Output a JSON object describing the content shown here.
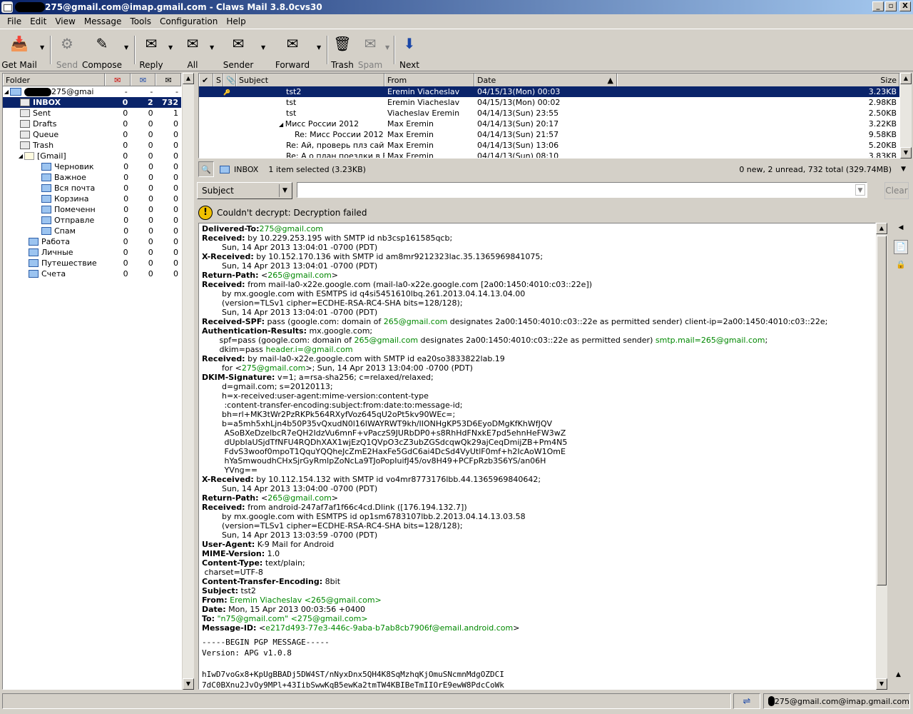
{
  "window": {
    "title": "275@gmail.com@imap.gmail.com - Claws Mail 3.8.0cvs30",
    "buttons": [
      "_",
      "▫",
      "X"
    ]
  },
  "menu": [
    "File",
    "Edit",
    "View",
    "Message",
    "Tools",
    "Configuration",
    "Help"
  ],
  "toolbar": {
    "get_mail": "Get Mail",
    "send": "Send",
    "compose": "Compose",
    "reply": "Reply",
    "all": "All",
    "sender": "Sender",
    "forward": "Forward",
    "trash": "Trash",
    "spam": "Spam",
    "next": "Next"
  },
  "folders": {
    "header": "Folder",
    "account": "275@gmai",
    "account_counts": [
      "-",
      "-",
      "-"
    ],
    "items": [
      {
        "name": "INBOX",
        "new": "0",
        "unread": "2",
        "total": "732"
      },
      {
        "name": "Sent",
        "new": "0",
        "unread": "0",
        "total": "1"
      },
      {
        "name": "Drafts",
        "new": "0",
        "unread": "0",
        "total": "0"
      },
      {
        "name": "Queue",
        "new": "0",
        "unread": "0",
        "total": "0"
      },
      {
        "name": "Trash",
        "new": "0",
        "unread": "0",
        "total": "0"
      },
      {
        "name": "[Gmail]",
        "new": "0",
        "unread": "0",
        "total": "0"
      },
      {
        "name": "Черновик",
        "new": "0",
        "unread": "0",
        "total": "0"
      },
      {
        "name": "Важное",
        "new": "0",
        "unread": "0",
        "total": "0"
      },
      {
        "name": "Вся почта",
        "new": "0",
        "unread": "0",
        "total": "0"
      },
      {
        "name": "Корзина",
        "new": "0",
        "unread": "0",
        "total": "0"
      },
      {
        "name": "Помеченн",
        "new": "0",
        "unread": "0",
        "total": "0"
      },
      {
        "name": "Отправле",
        "new": "0",
        "unread": "0",
        "total": "0"
      },
      {
        "name": "Спам",
        "new": "0",
        "unread": "0",
        "total": "0"
      },
      {
        "name": "Работа",
        "new": "0",
        "unread": "0",
        "total": "0"
      },
      {
        "name": "Личные",
        "new": "0",
        "unread": "0",
        "total": "0"
      },
      {
        "name": "Путешествие",
        "new": "0",
        "unread": "0",
        "total": "0"
      },
      {
        "name": "Счета",
        "new": "0",
        "unread": "0",
        "total": "0"
      }
    ]
  },
  "messages": {
    "columns": {
      "s": "S",
      "subject": "Subject",
      "from": "From",
      "date": "Date",
      "size": "Size"
    },
    "rows": [
      {
        "subject": "tst2",
        "from": "Eremin Viacheslav",
        "date": "04/15/13(Mon) 00:03",
        "size": "3.23KB"
      },
      {
        "subject": "tst",
        "from": "Eremin Viacheslav",
        "date": "04/15/13(Mon) 00:02",
        "size": "2.98KB"
      },
      {
        "subject": "tst",
        "from": "Viacheslav Eremin",
        "date": "04/14/13(Sun) 23:55",
        "size": "2.50KB"
      },
      {
        "subject": "Мисс России 2012",
        "from": "Max Eremin",
        "date": "04/14/13(Sun) 20:17",
        "size": "3.22KB"
      },
      {
        "subject": "Re: Мисс России 2012",
        "from": "Max Eremin",
        "date": "04/14/13(Sun) 21:57",
        "size": "9.58KB"
      },
      {
        "subject": "Re: Ай, проверь плз сайт http://rusbc",
        "from": "Max Eremin",
        "date": "04/14/13(Sun) 13:06",
        "size": "5.20KB"
      },
      {
        "subject": "Re: А о план поездки в Бургас перед",
        "from": "Max Eremin",
        "date": "04/14/13(Sun) 08:10",
        "size": "3.83KB"
      }
    ]
  },
  "status_row": {
    "folder": "INBOX",
    "selected": "1 item selected (3.23KB)",
    "totals": "0 new, 2 unread, 732 total (329.74MB)"
  },
  "quicksearch": {
    "type": "Subject",
    "clear": "Clear"
  },
  "warning": "Couldn't decrypt: Decryption failed",
  "headers": [
    {
      "k": "Delivered-To:",
      "v": "",
      "g": "275@gmail.com"
    },
    {
      "k": "Received:",
      "v": " by 10.229.253.195 with SMTP id nb3csp161585qcb;"
    },
    {
      "k": "",
      "v": "        Sun, 14 Apr 2013 13:04:01 -0700 (PDT)"
    },
    {
      "k": "X-Received:",
      "v": " by 10.152.170.136 with SMTP id am8mr9212323lac.35.1365969841075;"
    },
    {
      "k": "",
      "v": "        Sun, 14 Apr 2013 13:04:01 -0700 (PDT)"
    },
    {
      "k": "Return-Path:",
      "v": " <",
      "g": "265@gmail.com",
      "v2": ">"
    },
    {
      "k": "Received:",
      "v": " from mail-la0-x22e.google.com (mail-la0-x22e.google.com [2a00:1450:4010:c03::22e])"
    },
    {
      "k": "",
      "v": "        by mx.google.com with ESMTPS id q4si5451610lbq.261.2013.04.14.13.04.00"
    },
    {
      "k": "",
      "v": "        (version=TLSv1 cipher=ECDHE-RSA-RC4-SHA bits=128/128);"
    },
    {
      "k": "",
      "v": "        Sun, 14 Apr 2013 13:04:01 -0700 (PDT)"
    },
    {
      "k": "Received-SPF:",
      "v": " pass (google.com: domain of ",
      "g": "265@gmail.com",
      "v2": " designates 2a00:1450:4010:c03::22e as permitted sender) client-ip=2a00:1450:4010:c03::22e;"
    },
    {
      "k": "Authentication-Results:",
      "v": " mx.google.com;"
    },
    {
      "k": "",
      "v": "       spf=pass (google.com: domain of ",
      "g": "265@gmail.com",
      "v2": " designates 2a00:1450:4010:c03::22e as permitted sender) ",
      "g2": "smtp.mail=",
      "g3": "265@gmail.com",
      "v3": ";"
    },
    {
      "k": "",
      "v": "       dkim=pass ",
      "g": "header.i=@gmail.com"
    },
    {
      "k": "Received:",
      "v": " by mail-la0-x22e.google.com with SMTP id ea20so3833822lab.19"
    },
    {
      "k": "",
      "v": "        for <",
      "g": "275@gmail.com",
      "v2": ">; Sun, 14 Apr 2013 13:04:00 -0700 (PDT)"
    },
    {
      "k": "DKIM-Signature:",
      "v": " v=1; a=rsa-sha256; c=relaxed/relaxed;"
    },
    {
      "k": "",
      "v": "        d=gmail.com; s=20120113;"
    },
    {
      "k": "",
      "v": "        h=x-received:user-agent:mime-version:content-type"
    },
    {
      "k": "",
      "v": "         :content-transfer-encoding:subject:from:date:to:message-id;"
    },
    {
      "k": "",
      "v": "        bh=rl+MK3tWr2PzRKPk564RXyfVoz645qU2oPt5kv90WEc=;"
    },
    {
      "k": "",
      "v": "        b=a5mh5xhLjn4b50P35vQxudN0l16IWAYRWT9kh/IIONHgKP53D6EyoDMgKfKhWfJQV"
    },
    {
      "k": "",
      "v": "         ASoBXeDzelbcR7eQH2IdzVu6mnF+vPaczS9JURbDP0+s8RhHdFNxkE7pd5ehnHeFW3wZ"
    },
    {
      "k": "",
      "v": "         dUpbIaUSjdTfNFU4RQDhXAX1wjEzQ1QVpO3cZ3ubZGSdcqwQk29ajCeqDmijZB+Pm4N5"
    },
    {
      "k": "",
      "v": "         FdvS3woof0mpoT1QquYQQheJcZmE2HaxFe5GdC6ai4DcSd4VyUtlF0mf+h2IcAoW1OmE"
    },
    {
      "k": "",
      "v": "         hYaSmwoudhCHxSjrGyRmlpZoNcLa9TJoPopIuifJ45/ov8H49+PCFpRzb3S6YS/an06H"
    },
    {
      "k": "",
      "v": "         YVng=="
    },
    {
      "k": "X-Received:",
      "v": " by 10.112.154.132 with SMTP id vo4mr8773176lbb.44.1365969840642;"
    },
    {
      "k": "",
      "v": "        Sun, 14 Apr 2013 13:04:00 -0700 (PDT)"
    },
    {
      "k": "Return-Path:",
      "v": " <",
      "g": "265@gmail.com",
      "v2": ">"
    },
    {
      "k": "Received:",
      "v": " from android-247af7af1f66c4cd.Dlink ([176.194.132.7])"
    },
    {
      "k": "",
      "v": "        by mx.google.com with ESMTPS id op1sm6783107lbb.2.2013.04.14.13.03.58"
    },
    {
      "k": "",
      "v": "        (version=TLSv1 cipher=ECDHE-RSA-RC4-SHA bits=128/128);"
    },
    {
      "k": "",
      "v": "        Sun, 14 Apr 2013 13:03:59 -0700 (PDT)"
    },
    {
      "k": "User-Agent:",
      "v": " K-9 Mail for Android"
    },
    {
      "k": "MIME-Version:",
      "v": " 1.0"
    },
    {
      "k": "Content-Type:",
      "v": " text/plain;"
    },
    {
      "k": "",
      "v": " charset=UTF-8"
    },
    {
      "k": "Content-Transfer-Encoding:",
      "v": " 8bit"
    },
    {
      "k": "Subject:",
      "v": " tst2"
    },
    {
      "k": "From:",
      "v": " ",
      "g": "Eremin Viacheslav <",
      "g2": "265@gmail.com>"
    },
    {
      "k": "Date:",
      "v": " Mon, 15 Apr 2013 00:03:56 +0400"
    },
    {
      "k": "To:",
      "v": " ",
      "g": "\"n",
      "g2": "75@gmail.com\" <",
      "g3": "275@gmail.com>"
    },
    {
      "k": "Message-ID:",
      "v": " <",
      "g": "e217d493-77e3-446c-9aba-b7ab8cb7906f@email.android.com",
      "v2": ">"
    }
  ],
  "pgp": [
    "-----BEGIN PGP MESSAGE-----",
    "Version: APG v1.0.8",
    "",
    "hIwD7voGx8+KpUgBBADj5DW4ST/nNyxDnx5QH4K8SqMzhqKjOmuSNcmnMdgOZDCI",
    "7dC0BXnu2JvOy9MPl+43IibSwwKqB5ewKa2tmTW4KBIBeTmIIOrE9ewW8PdcCoWk"
  ],
  "statusbar": {
    "account": "275@gmail.com@imap.gmail.com"
  }
}
